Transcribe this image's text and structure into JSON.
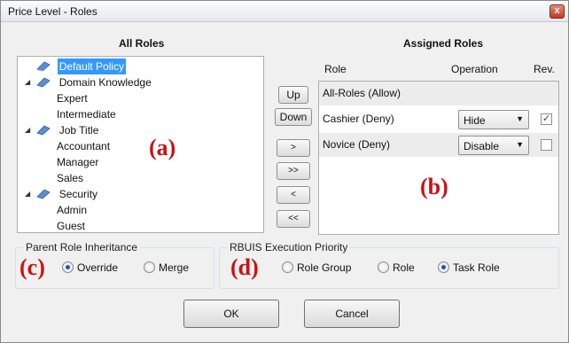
{
  "window": {
    "title": "Price Level - Roles",
    "close_glyph": "x"
  },
  "all_roles": {
    "heading": "All Roles",
    "tree": [
      {
        "label": "Default Policy",
        "icon": "role-icon",
        "selected": true
      },
      {
        "label": "Domain Knowledge",
        "icon": "role-icon",
        "expander": "◢"
      },
      {
        "label": "Expert"
      },
      {
        "label": "Intermediate"
      },
      {
        "label": "Job Title",
        "icon": "role-icon",
        "expander": "◢"
      },
      {
        "label": "Accountant"
      },
      {
        "label": "Manager"
      },
      {
        "label": "Sales"
      },
      {
        "label": "Security",
        "icon": "role-icon",
        "expander": "◢"
      },
      {
        "label": "Admin"
      },
      {
        "label": "Guest"
      }
    ]
  },
  "move_buttons": {
    "up": "Up",
    "down": "Down",
    "add": ">",
    "add_all": ">>",
    "remove": "<",
    "remove_all": "<<"
  },
  "assigned_roles": {
    "heading": "Assigned Roles",
    "columns": {
      "role": "Role",
      "operation": "Operation",
      "rev": "Rev."
    },
    "rows": [
      {
        "role": "All-Roles (Allow)"
      },
      {
        "role": "Cashier (Deny)",
        "operation": "Hide",
        "rev": true
      },
      {
        "role": "Novice (Deny)",
        "operation": "Disable",
        "rev": false
      }
    ]
  },
  "parent_inheritance": {
    "title": "Parent Role Inheritance",
    "options": [
      {
        "label": "Override",
        "selected": true
      },
      {
        "label": "Merge",
        "selected": false
      }
    ]
  },
  "execution_priority": {
    "title": "RBUIS Execution Priority",
    "options": [
      {
        "label": "Role Group",
        "selected": false
      },
      {
        "label": "Role",
        "selected": false
      },
      {
        "label": "Task Role",
        "selected": true
      }
    ]
  },
  "annotations": {
    "a": "(a)",
    "b": "(b)",
    "c": "(c)",
    "d": "(d)"
  },
  "footer": {
    "ok": "OK",
    "cancel": "Cancel"
  },
  "colors": {
    "annotation": "#cc1111",
    "selection": "#3399ff",
    "close_button": "#c4361d"
  }
}
